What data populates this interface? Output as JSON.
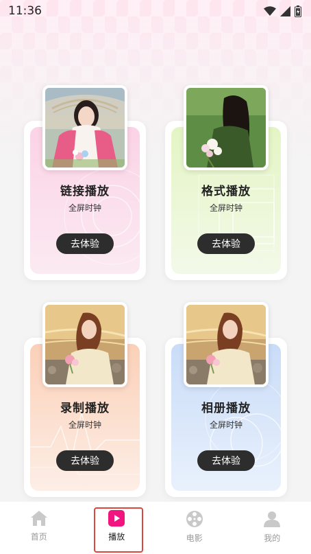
{
  "status_bar": {
    "time": "11:36",
    "icons": [
      "wifi-icon",
      "cell-signal-icon",
      "battery-icon"
    ]
  },
  "cards": [
    {
      "title": "链接播放",
      "subtitle": "全屏时钟",
      "button_label": "去体验",
      "theme": "pink",
      "colors": {
        "top": "#fbd3e6",
        "bottom": "#fbeaf2"
      },
      "photo": "girl-pink-cardigan-photo"
    },
    {
      "title": "格式播放",
      "subtitle": "全屏时钟",
      "button_label": "去体验",
      "theme": "green",
      "colors": {
        "top": "#e4f5c4",
        "bottom": "#f3f9e9"
      },
      "photo": "girl-green-field-photo"
    },
    {
      "title": "录制播放",
      "subtitle": "全屏时钟",
      "button_label": "去体验",
      "theme": "peach",
      "colors": {
        "top": "#fbd0b8",
        "bottom": "#fdeee6"
      },
      "photo": "girl-seaside-photo"
    },
    {
      "title": "相册播放",
      "subtitle": "全屏时钟",
      "button_label": "去体验",
      "theme": "blue",
      "colors": {
        "top": "#c9dcf8",
        "bottom": "#e9f1fc"
      },
      "photo": "girl-seaside-photo"
    }
  ],
  "tabbar": {
    "items": [
      {
        "label": "首页",
        "icon": "home-icon",
        "active": false
      },
      {
        "label": "播放",
        "icon": "play-icon",
        "active": true
      },
      {
        "label": "电影",
        "icon": "film-reel-icon",
        "active": false
      },
      {
        "label": "我的",
        "icon": "user-icon",
        "active": false
      }
    ],
    "active_color": "#f0157f",
    "highlight_color": "#d9473d"
  }
}
